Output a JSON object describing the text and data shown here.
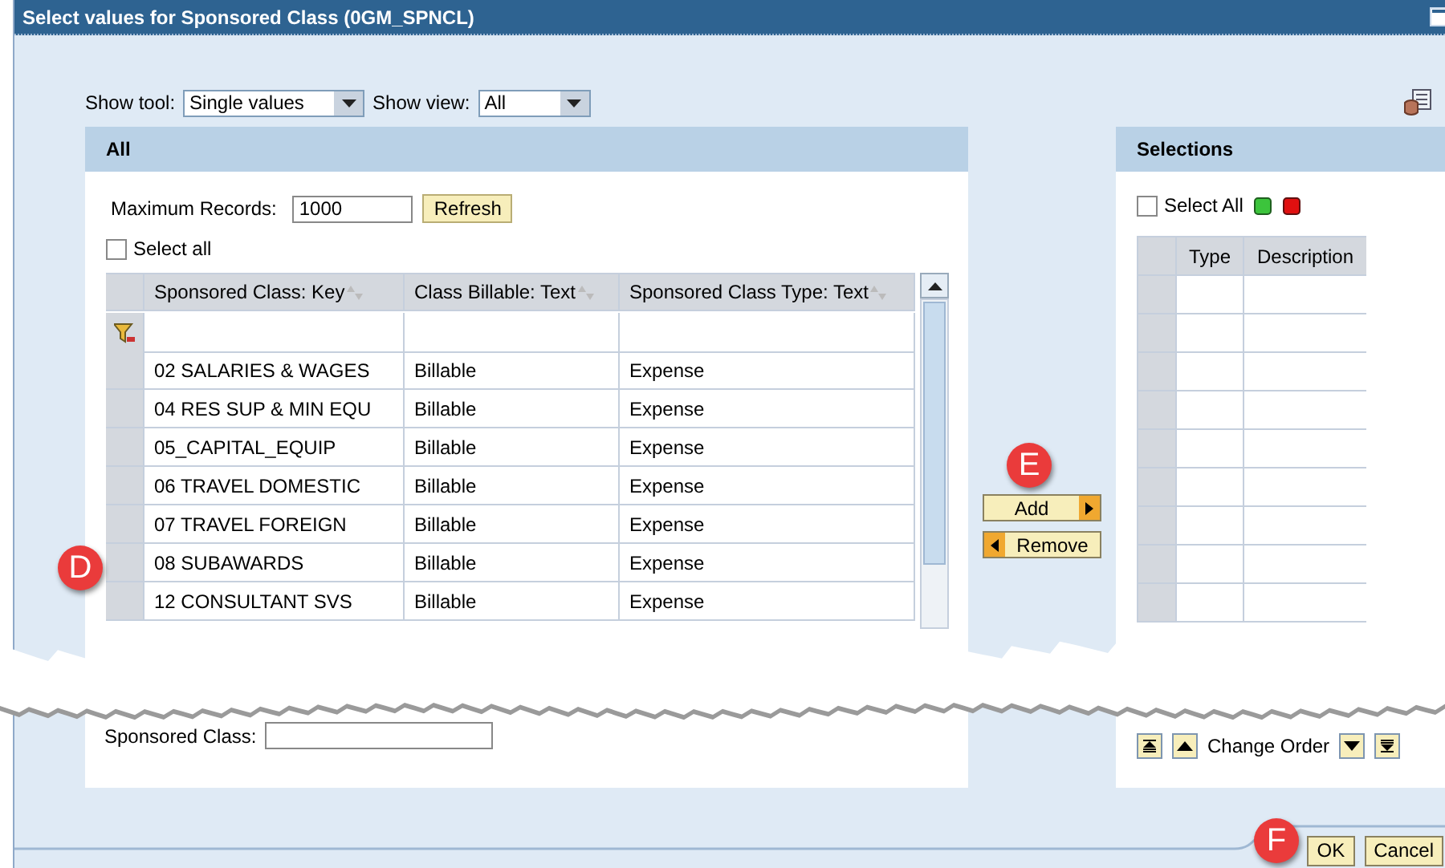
{
  "window": {
    "title": "Select values for Sponsored Class (0GM_SPNCL)"
  },
  "toolbar": {
    "show_tool": {
      "label": "Show tool:",
      "value": "Single values"
    },
    "show_view": {
      "label": "Show view:",
      "value": "All"
    }
  },
  "all_panel": {
    "title": "All",
    "max_records": {
      "label": "Maximum Records:",
      "value": "1000"
    },
    "refresh_button": "Refresh",
    "select_all": {
      "label": "Select all",
      "checked": false
    },
    "table": {
      "columns": [
        "Sponsored Class: Key",
        "Class Billable: Text",
        "Sponsored Class Type: Text"
      ],
      "rows": [
        {
          "cells": [
            "02 SALARIES & WAGES",
            "Billable",
            "Expense"
          ]
        },
        {
          "cells": [
            "04 RES SUP & MIN EQU",
            "Billable",
            "Expense"
          ]
        },
        {
          "cells": [
            "05_CAPITAL_EQUIP",
            "Billable",
            "Expense"
          ]
        },
        {
          "cells": [
            "06 TRAVEL DOMESTIC",
            "Billable",
            "Expense"
          ]
        },
        {
          "cells": [
            "07 TRAVEL FOREIGN",
            "Billable",
            "Expense"
          ]
        },
        {
          "cells": [
            "08 SUBAWARDS",
            "Billable",
            "Expense"
          ]
        },
        {
          "cells": [
            "12 CONSULTANT SVS",
            "Billable",
            "Expense"
          ]
        }
      ]
    },
    "search_field": {
      "label": "Sponsored Class:"
    }
  },
  "transfer_buttons": [
    {
      "label": "Add",
      "kind": "add"
    },
    {
      "label": "Remove",
      "kind": "remove"
    }
  ],
  "selections_panel": {
    "title": "Selections",
    "select_all": {
      "label": "Select All",
      "checked": false
    },
    "columns": [
      "Type",
      "Description"
    ],
    "change_order": "Change Order"
  },
  "buttons": [
    "OK",
    "Cancel"
  ],
  "callouts": [
    "D",
    "E",
    "F"
  ]
}
